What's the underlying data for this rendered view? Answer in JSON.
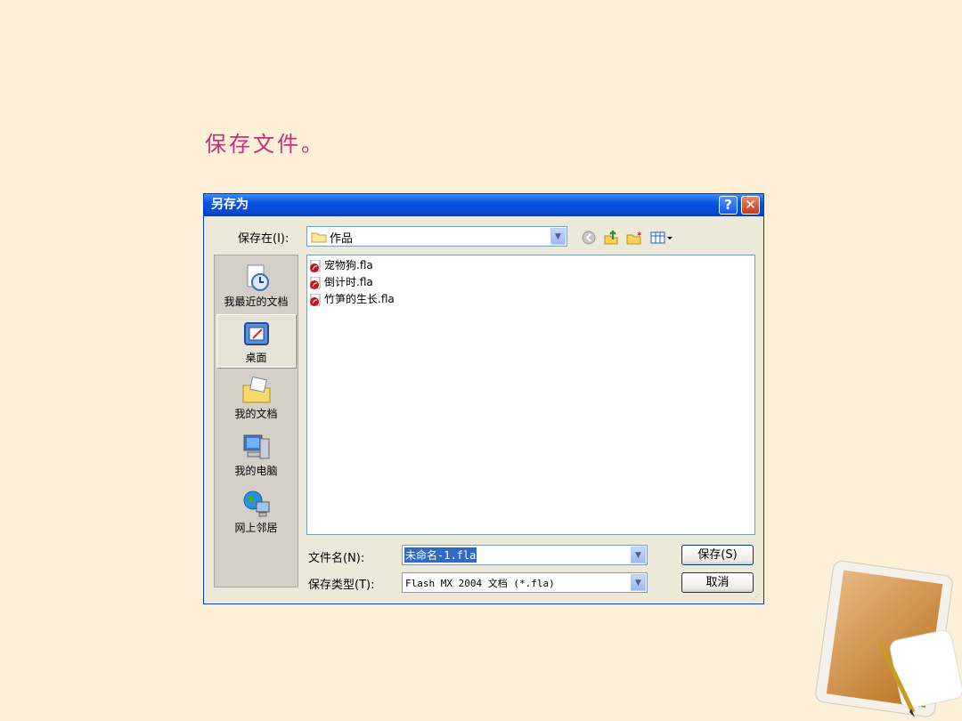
{
  "slide": {
    "title": "保存文件。"
  },
  "dialog": {
    "title": "另存为",
    "help_label": "?",
    "close_label": "✕",
    "save_in_label": "保存在(I):",
    "save_in_value": "作品",
    "places": [
      {
        "label": "我最近的文档",
        "icon": "recent-documents-icon"
      },
      {
        "label": "桌面",
        "icon": "desktop-icon"
      },
      {
        "label": "我的文档",
        "icon": "my-documents-icon"
      },
      {
        "label": "我的电脑",
        "icon": "my-computer-icon"
      },
      {
        "label": "网上邻居",
        "icon": "network-places-icon"
      }
    ],
    "files": [
      {
        "name": "宠物狗.fla",
        "icon": "flash-file-icon"
      },
      {
        "name": "倒计时.fla",
        "icon": "flash-file-icon"
      },
      {
        "name": "竹笋的生长.fla",
        "icon": "flash-file-icon"
      }
    ],
    "filename_label": "文件名(N):",
    "filename_value": "未命名-1.fla",
    "filetype_label": "保存类型(T):",
    "filetype_value": "Flash MX 2004 文档 (*.fla)",
    "save_button": "保存(S)",
    "cancel_button": "取消"
  },
  "colors": {
    "background": "#fdf0d6",
    "title": "#c4307a",
    "titlebar": "#0a46d0"
  }
}
